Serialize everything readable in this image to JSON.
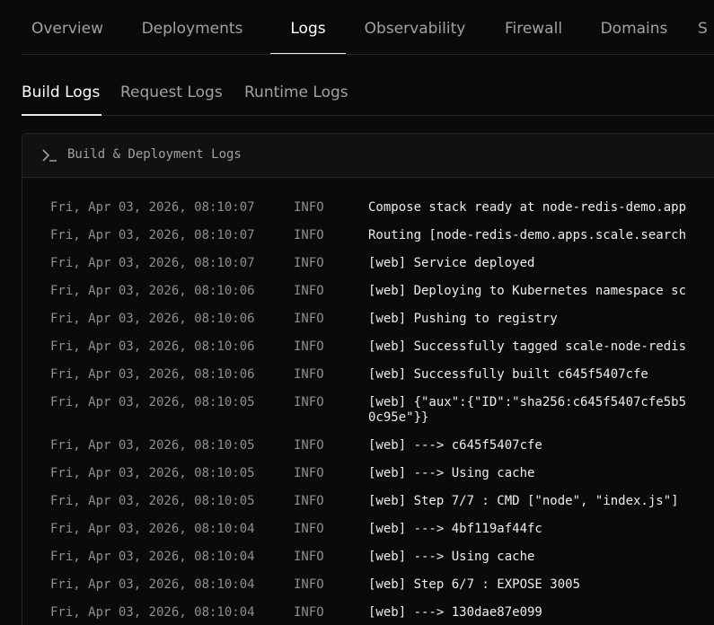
{
  "top_nav": {
    "tabs": [
      {
        "label": "Overview",
        "active": false
      },
      {
        "label": "Deployments",
        "active": false
      },
      {
        "label": "Logs",
        "active": true
      },
      {
        "label": "Observability",
        "active": false
      },
      {
        "label": "Firewall",
        "active": false
      },
      {
        "label": "Domains",
        "active": false
      },
      {
        "label": "S",
        "active": false
      }
    ]
  },
  "sub_nav": {
    "tabs": [
      {
        "label": "Build Logs",
        "active": true
      },
      {
        "label": "Request Logs",
        "active": false
      },
      {
        "label": "Runtime Logs",
        "active": false
      }
    ]
  },
  "log_panel": {
    "icon": "terminal-icon",
    "title": "Build & Deployment Logs",
    "rows": [
      {
        "time": "Fri, Apr 03, 2026, 08:10:07",
        "level": "INFO",
        "message": "Compose stack ready at node-redis-demo.app"
      },
      {
        "time": "Fri, Apr 03, 2026, 08:10:07",
        "level": "INFO",
        "message": "Routing [node-redis-demo.apps.scale.search"
      },
      {
        "time": "Fri, Apr 03, 2026, 08:10:07",
        "level": "INFO",
        "message": "[web] Service deployed"
      },
      {
        "time": "Fri, Apr 03, 2026, 08:10:06",
        "level": "INFO",
        "message": "[web] Deploying to Kubernetes namespace sc"
      },
      {
        "time": "Fri, Apr 03, 2026, 08:10:06",
        "level": "INFO",
        "message": "[web] Pushing to registry"
      },
      {
        "time": "Fri, Apr 03, 2026, 08:10:06",
        "level": "INFO",
        "message": "[web] Successfully tagged scale-node-redis"
      },
      {
        "time": "Fri, Apr 03, 2026, 08:10:06",
        "level": "INFO",
        "message": "[web] Successfully built c645f5407cfe"
      },
      {
        "time": "Fri, Apr 03, 2026, 08:10:05",
        "level": "INFO",
        "message": "[web] {\"aux\":{\"ID\":\"sha256:c645f5407cfe5b5\n0c95e\"}}"
      },
      {
        "time": "Fri, Apr 03, 2026, 08:10:05",
        "level": "INFO",
        "message": "[web] ---> c645f5407cfe"
      },
      {
        "time": "Fri, Apr 03, 2026, 08:10:05",
        "level": "INFO",
        "message": "[web] ---> Using cache"
      },
      {
        "time": "Fri, Apr 03, 2026, 08:10:05",
        "level": "INFO",
        "message": "[web] Step 7/7 : CMD [\"node\", \"index.js\"]"
      },
      {
        "time": "Fri, Apr 03, 2026, 08:10:04",
        "level": "INFO",
        "message": "[web] ---> 4bf119af44fc"
      },
      {
        "time": "Fri, Apr 03, 2026, 08:10:04",
        "level": "INFO",
        "message": "[web] ---> Using cache"
      },
      {
        "time": "Fri, Apr 03, 2026, 08:10:04",
        "level": "INFO",
        "message": "[web] Step 6/7 : EXPOSE 3005"
      },
      {
        "time": "Fri, Apr 03, 2026, 08:10:04",
        "level": "INFO",
        "message": "[web] ---> 130dae87e099"
      }
    ]
  }
}
